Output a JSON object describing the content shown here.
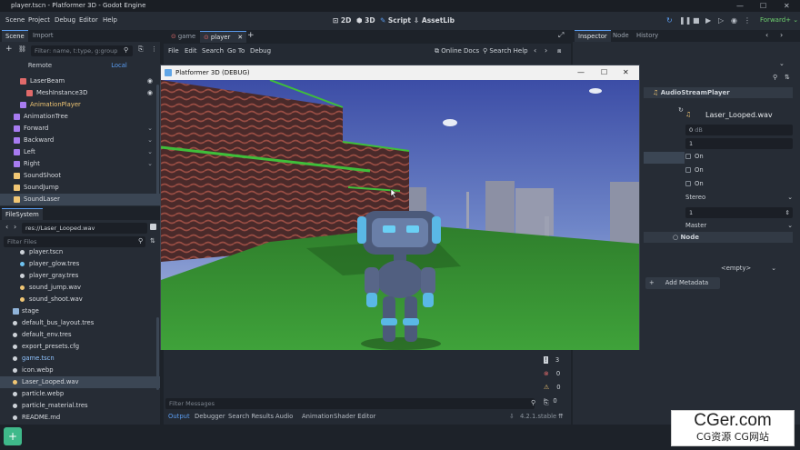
{
  "window": {
    "title": "player.tscn - Platformer 3D - Godot Engine"
  },
  "menu": [
    "Scene",
    "Project",
    "Debug",
    "Editor",
    "Help"
  ],
  "workspaces": [
    {
      "label": "2D",
      "icon": "2d-icon"
    },
    {
      "label": "3D",
      "icon": "3d-icon"
    },
    {
      "label": "Script",
      "icon": "script-icon",
      "active": true
    },
    {
      "label": "AssetLib",
      "icon": "assetlib-icon"
    }
  ],
  "renderer": "Forward+",
  "scene_dock": {
    "tabs": [
      "Scene",
      "Import"
    ],
    "filter_placeholder": "Filter: name, t:type, g:group",
    "remote": "Remote",
    "local": "Local",
    "nodes": [
      {
        "label": "LaserBeam",
        "indent": 2,
        "color": "#e06a6a",
        "eye": true
      },
      {
        "label": "MeshInstance3D",
        "indent": 3,
        "color": "#e06a6a",
        "eye": true
      },
      {
        "label": "AnimationPlayer",
        "indent": 2,
        "color": "#a77bf0",
        "eye": false,
        "highlight": true
      },
      {
        "label": "AnimationTree",
        "indent": 1,
        "color": "#a77bf0",
        "eye": false
      },
      {
        "label": "Forward",
        "indent": 1,
        "color": "#a77bf0",
        "eye": false,
        "chev": true
      },
      {
        "label": "Backward",
        "indent": 1,
        "color": "#a77bf0",
        "eye": false,
        "chev": true
      },
      {
        "label": "Left",
        "indent": 1,
        "color": "#a77bf0",
        "eye": false,
        "chev": true
      },
      {
        "label": "Right",
        "indent": 1,
        "color": "#a77bf0",
        "eye": false,
        "chev": true
      },
      {
        "label": "SoundShoot",
        "indent": 1,
        "color": "#f0c674",
        "eye": false
      },
      {
        "label": "SoundJump",
        "indent": 1,
        "color": "#f0c674",
        "eye": false
      },
      {
        "label": "SoundLaser",
        "indent": 1,
        "color": "#f0c674",
        "eye": false,
        "selected": true
      }
    ]
  },
  "filesystem": {
    "tab": "FileSystem",
    "path": "res://Laser_Looped.wav",
    "filter_placeholder": "Filter Files",
    "files": [
      {
        "label": "player.tscn",
        "indent": 2,
        "color": "#cdd2d8"
      },
      {
        "label": "player_glow.tres",
        "indent": 2,
        "color": "#6ec2f0"
      },
      {
        "label": "player_gray.tres",
        "indent": 2,
        "color": "#cdd2d8"
      },
      {
        "label": "sound_jump.wav",
        "indent": 2,
        "color": "#f0c674"
      },
      {
        "label": "sound_shoot.wav",
        "indent": 2,
        "color": "#f0c674"
      },
      {
        "label": "stage",
        "indent": 1,
        "color": "#8fb3d9",
        "folder": true
      },
      {
        "label": "default_bus_layout.tres",
        "indent": 1,
        "color": "#cdd2d8"
      },
      {
        "label": "default_env.tres",
        "indent": 1,
        "color": "#cdd2d8"
      },
      {
        "label": "export_presets.cfg",
        "indent": 1,
        "color": "#cdd2d8"
      },
      {
        "label": "game.tscn",
        "indent": 1,
        "color": "#cdd2d8",
        "blue": true
      },
      {
        "label": "icon.webp",
        "indent": 1,
        "color": "#cdd2d8"
      },
      {
        "label": "Laser_Looped.wav",
        "indent": 1,
        "color": "#f0c674",
        "selected": true
      },
      {
        "label": "particle.webp",
        "indent": 1,
        "color": "#cdd2d8"
      },
      {
        "label": "particle_material.tres",
        "indent": 1,
        "color": "#cdd2d8"
      },
      {
        "label": "README.md",
        "indent": 1,
        "color": "#cdd2d8"
      }
    ]
  },
  "script_editor": {
    "tabs": [
      "game",
      "player"
    ],
    "menu": [
      "File",
      "Edit",
      "Search",
      "Go To",
      "Debug"
    ],
    "online_docs": "Online Docs",
    "search_help": "Search Help",
    "filter_messages": "Filter Messages",
    "counts": {
      "info": "3",
      "errors": "0",
      "warnings": "0",
      "messages": "0"
    }
  },
  "game_window": {
    "title": "Platformer 3D (DEBUG)"
  },
  "inspector": {
    "tabs": [
      "Inspector",
      "Node",
      "History"
    ],
    "class_name": "AudioStreamPlayer",
    "stream": "Laser_Looped.wav",
    "volume_db": "0",
    "volume_unit": "dB",
    "pitch_scale": "1",
    "playing": "On",
    "autoplay": "On",
    "stream_paused": "On",
    "mix_target": "Stereo",
    "max_polyphony": "1",
    "bus": "Master",
    "section_node": "Node",
    "metadata_empty": "<empty>",
    "add_metadata": "Add Metadata"
  },
  "bottom_panel": {
    "tabs": [
      "Output",
      "Debugger",
      "Search Results",
      "Audio",
      "Animation",
      "Shader Editor"
    ],
    "version": "4.2.1.stable"
  },
  "watermark": {
    "line1": "CGer.com",
    "line2": "CG资源 CG网站"
  }
}
